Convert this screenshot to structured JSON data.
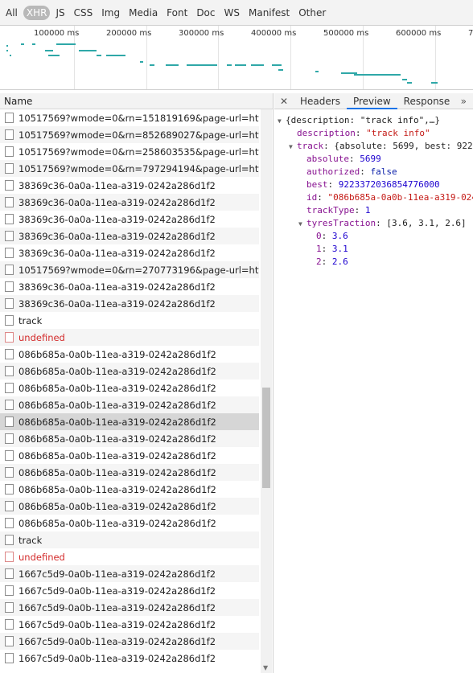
{
  "filters": [
    "All",
    "XHR",
    "JS",
    "CSS",
    "Img",
    "Media",
    "Font",
    "Doc",
    "WS",
    "Manifest",
    "Other"
  ],
  "active_filter": "XHR",
  "timeline_ticks": [
    "100000 ms",
    "200000 ms",
    "300000 ms",
    "400000 ms",
    "500000 ms",
    "600000 ms",
    "7"
  ],
  "list": {
    "header": "Name",
    "rows": [
      {
        "name": "10517569?wmode=0&rn=151819169&page-url=https%",
        "error": false,
        "selected": false
      },
      {
        "name": "10517569?wmode=0&rn=852689027&page-url=https%",
        "error": false,
        "selected": false
      },
      {
        "name": "10517569?wmode=0&rn=258603535&page-url=https%",
        "error": false,
        "selected": false
      },
      {
        "name": "10517569?wmode=0&rn=797294194&page-url=https%",
        "error": false,
        "selected": false
      },
      {
        "name": "38369c36-0a0a-11ea-a319-0242a286d1f2",
        "error": false,
        "selected": false
      },
      {
        "name": "38369c36-0a0a-11ea-a319-0242a286d1f2",
        "error": false,
        "selected": false
      },
      {
        "name": "38369c36-0a0a-11ea-a319-0242a286d1f2",
        "error": false,
        "selected": false
      },
      {
        "name": "38369c36-0a0a-11ea-a319-0242a286d1f2",
        "error": false,
        "selected": false
      },
      {
        "name": "38369c36-0a0a-11ea-a319-0242a286d1f2",
        "error": false,
        "selected": false
      },
      {
        "name": "10517569?wmode=0&rn=270773196&page-url=https%",
        "error": false,
        "selected": false
      },
      {
        "name": "38369c36-0a0a-11ea-a319-0242a286d1f2",
        "error": false,
        "selected": false
      },
      {
        "name": "38369c36-0a0a-11ea-a319-0242a286d1f2",
        "error": false,
        "selected": false
      },
      {
        "name": "track",
        "error": false,
        "selected": false
      },
      {
        "name": "undefined",
        "error": true,
        "selected": false
      },
      {
        "name": "086b685a-0a0b-11ea-a319-0242a286d1f2",
        "error": false,
        "selected": false
      },
      {
        "name": "086b685a-0a0b-11ea-a319-0242a286d1f2",
        "error": false,
        "selected": false
      },
      {
        "name": "086b685a-0a0b-11ea-a319-0242a286d1f2",
        "error": false,
        "selected": false
      },
      {
        "name": "086b685a-0a0b-11ea-a319-0242a286d1f2",
        "error": false,
        "selected": false
      },
      {
        "name": "086b685a-0a0b-11ea-a319-0242a286d1f2",
        "error": false,
        "selected": true
      },
      {
        "name": "086b685a-0a0b-11ea-a319-0242a286d1f2",
        "error": false,
        "selected": false
      },
      {
        "name": "086b685a-0a0b-11ea-a319-0242a286d1f2",
        "error": false,
        "selected": false
      },
      {
        "name": "086b685a-0a0b-11ea-a319-0242a286d1f2",
        "error": false,
        "selected": false
      },
      {
        "name": "086b685a-0a0b-11ea-a319-0242a286d1f2",
        "error": false,
        "selected": false
      },
      {
        "name": "086b685a-0a0b-11ea-a319-0242a286d1f2",
        "error": false,
        "selected": false
      },
      {
        "name": "086b685a-0a0b-11ea-a319-0242a286d1f2",
        "error": false,
        "selected": false
      },
      {
        "name": "track",
        "error": false,
        "selected": false
      },
      {
        "name": "undefined",
        "error": true,
        "selected": false
      },
      {
        "name": "1667c5d9-0a0b-11ea-a319-0242a286d1f2",
        "error": false,
        "selected": false
      },
      {
        "name": "1667c5d9-0a0b-11ea-a319-0242a286d1f2",
        "error": false,
        "selected": false
      },
      {
        "name": "1667c5d9-0a0b-11ea-a319-0242a286d1f2",
        "error": false,
        "selected": false
      },
      {
        "name": "1667c5d9-0a0b-11ea-a319-0242a286d1f2",
        "error": false,
        "selected": false
      },
      {
        "name": "1667c5d9-0a0b-11ea-a319-0242a286d1f2",
        "error": false,
        "selected": false
      },
      {
        "name": "1667c5d9-0a0b-11ea-a319-0242a286d1f2",
        "error": false,
        "selected": false
      }
    ]
  },
  "detail": {
    "close_icon": "close-icon",
    "tabs": [
      "Headers",
      "Preview",
      "Response"
    ],
    "active_tab": "Preview",
    "more_label": "»",
    "preview": {
      "root": "{description: \"track info\",…}",
      "description_key": "description",
      "description_value": "\"track info\"",
      "track_key": "track",
      "track_summary": "{absolute: 5699, best: 922",
      "absolute_key": "absolute",
      "absolute_value": "5699",
      "authorized_key": "authorized",
      "authorized_value": "false",
      "best_key": "best",
      "best_value": "9223372036854776000",
      "id_key": "id",
      "id_value": "\"086b685a-0a0b-11ea-a319-024",
      "trackType_key": "trackType",
      "trackType_value": "1",
      "tyres_key": "tyresTraction",
      "tyres_summary": "[3.6, 3.1, 2.6]",
      "tyres": [
        {
          "index": "0",
          "value": "3.6"
        },
        {
          "index": "1",
          "value": "3.1"
        },
        {
          "index": "2",
          "value": "2.6"
        }
      ]
    }
  },
  "colors": {
    "timeline_bar": "#2fa8a8",
    "tab_accent": "#1a73e8",
    "error_text": "#d32b2b"
  }
}
